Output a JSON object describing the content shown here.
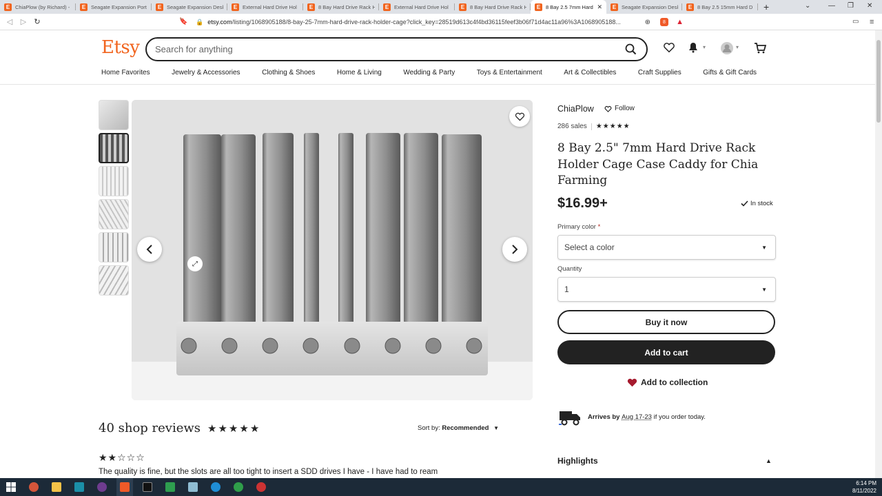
{
  "browser": {
    "tabs": [
      {
        "title": "ChiaPlow (by Richard) -"
      },
      {
        "title": "Seagate Expansion Port"
      },
      {
        "title": "Seagate Expansion Desk"
      },
      {
        "title": "External Hard Drive Hol"
      },
      {
        "title": "8 Bay Hard Drive Rack H"
      },
      {
        "title": "External Hard Drive Hol"
      },
      {
        "title": "8 Bay Hard Drive Rack H"
      },
      {
        "title": "8 Bay 2.5 7mm Hard"
      },
      {
        "title": "Seagate Expansion Desk"
      },
      {
        "title": "8 Bay 2.5 15mm Hard D"
      }
    ],
    "url_domain": "etsy.com",
    "url_path": "/listing/1068905188/8-bay-25-7mm-hard-drive-rack-holder-cage?click_key=28519d613c4f4bd36115feef3b06f71d4ac11a96%3A1068905188...",
    "extension_badge": "8"
  },
  "header": {
    "logo": "Etsy",
    "search_placeholder": "Search for anything"
  },
  "categories": [
    "Home Favorites",
    "Jewelry & Accessories",
    "Clothing & Shoes",
    "Home & Living",
    "Wedding & Party",
    "Toys & Entertainment",
    "Art & Collectibles",
    "Craft Supplies",
    "Gifts & Gift Cards"
  ],
  "listing": {
    "shop_name": "ChiaPlow",
    "follow_label": "Follow",
    "sales": "286 sales",
    "rating_stars": "★★★★★",
    "title": "8 Bay 2.5\" 7mm Hard Drive Rack Holder Cage Case Caddy for Chia Farming",
    "price": "$16.99+",
    "stock": "In stock",
    "primary_color_label": "Primary color",
    "required_mark": "*",
    "color_select": "Select a color",
    "quantity_label": "Quantity",
    "quantity_value": "1",
    "buy_now": "Buy it now",
    "add_to_cart": "Add to cart",
    "add_to_collection": "Add to collection",
    "arrives_prefix": "Arrives by ",
    "arrives_date": "Aug 17-23",
    "arrives_suffix": " if you order today.",
    "highlights": "Highlights"
  },
  "reviews": {
    "heading": "40 shop reviews",
    "stars": "★★★★★",
    "sort_prefix": "Sort by: ",
    "sort_value": "Recommended",
    "first_review_stars": "★★☆☆☆",
    "first_review_text": "The quality is fine, but the slots are all too tight to insert a SDD drives I have - I have had to ream"
  },
  "taskbar": {
    "time": "6:14 PM",
    "date": "8/11/2022"
  },
  "colors": {
    "etsy_orange": "#f1641e",
    "heart_red": "#a61a2e",
    "text_dark": "#222222"
  }
}
